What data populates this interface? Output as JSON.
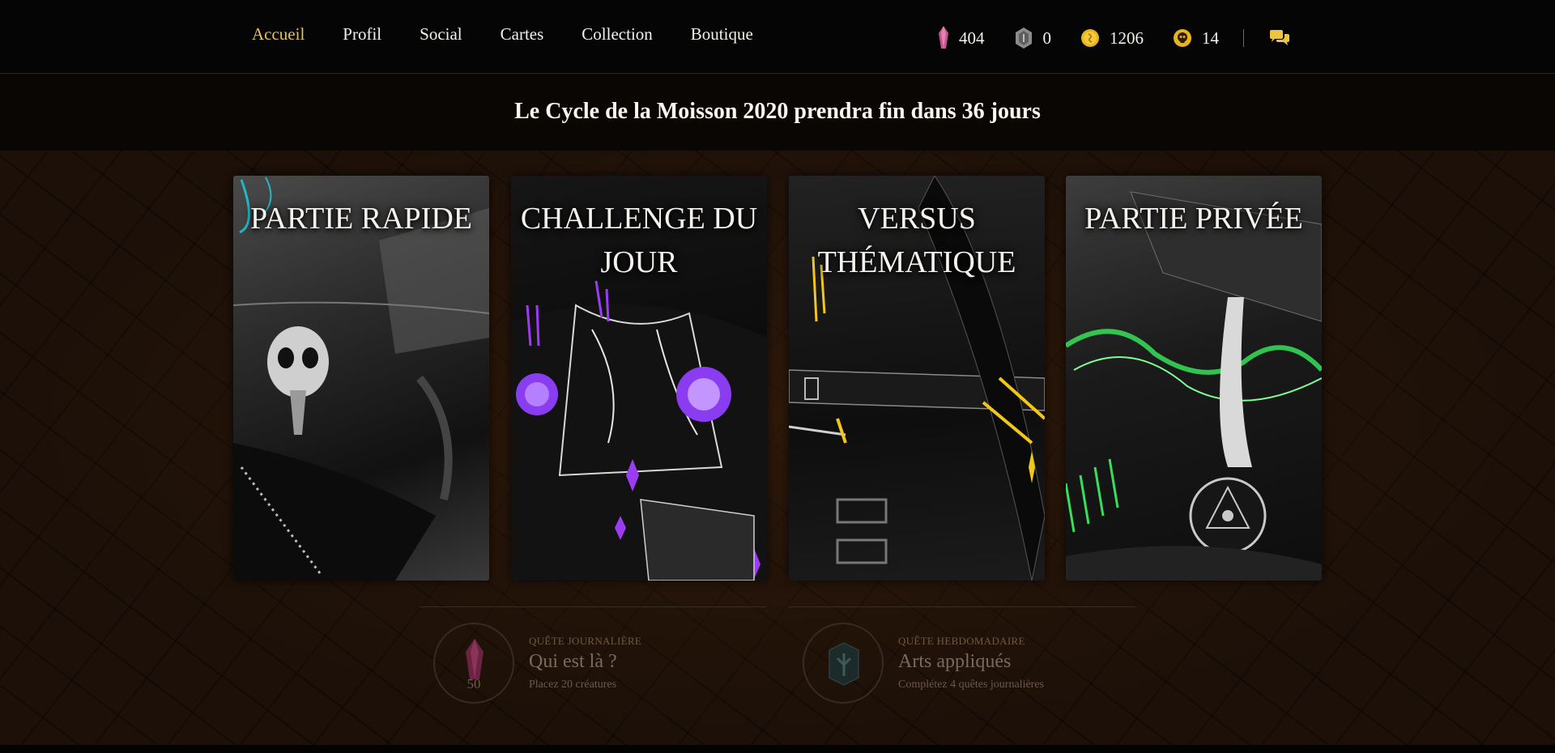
{
  "nav": {
    "links": [
      {
        "label": "Accueil",
        "active": true
      },
      {
        "label": "Profil",
        "active": false
      },
      {
        "label": "Social",
        "active": false
      },
      {
        "label": "Cartes",
        "active": false
      },
      {
        "label": "Collection",
        "active": false
      },
      {
        "label": "Boutique",
        "active": false
      }
    ],
    "currencies": [
      {
        "icon": "pink-shard-icon",
        "value": "404",
        "color": "#c7548f"
      },
      {
        "icon": "grey-stone-icon",
        "value": "0",
        "color": "#8a8a8a"
      },
      {
        "icon": "gold-coin-icon",
        "value": "1206",
        "color": "#e8b31d"
      },
      {
        "icon": "skull-token-icon",
        "value": "14",
        "color": "#e8b31d"
      }
    ],
    "chat_icon": "chat-bubbles-icon"
  },
  "banner": {
    "text": "Le Cycle de la Moisson 2020 prendra fin dans 36 jours"
  },
  "modes": [
    {
      "title": "PARTIE RAPIDE",
      "accent": "#21b8c4"
    },
    {
      "title": "CHALLENGE DU JOUR",
      "accent": "#9c3cf2"
    },
    {
      "title": "VERSUS THÉMATIQUE",
      "accent": "#f2c61a"
    },
    {
      "title": "PARTIE PRIVÉE",
      "accent": "#37e05a"
    }
  ],
  "quests": [
    {
      "type": "QUÊTE JOURNALIÈRE",
      "name": "Qui est là ?",
      "description": "Placez 20 créatures",
      "reward": "50",
      "icon": "pink-shard-icon"
    },
    {
      "type": "QUÊTE HEBDOMADAIRE",
      "name": "Arts appliqués",
      "description": "Complétez 4 quêtes journalières",
      "reward": "",
      "icon": "rune-stone-icon"
    }
  ]
}
